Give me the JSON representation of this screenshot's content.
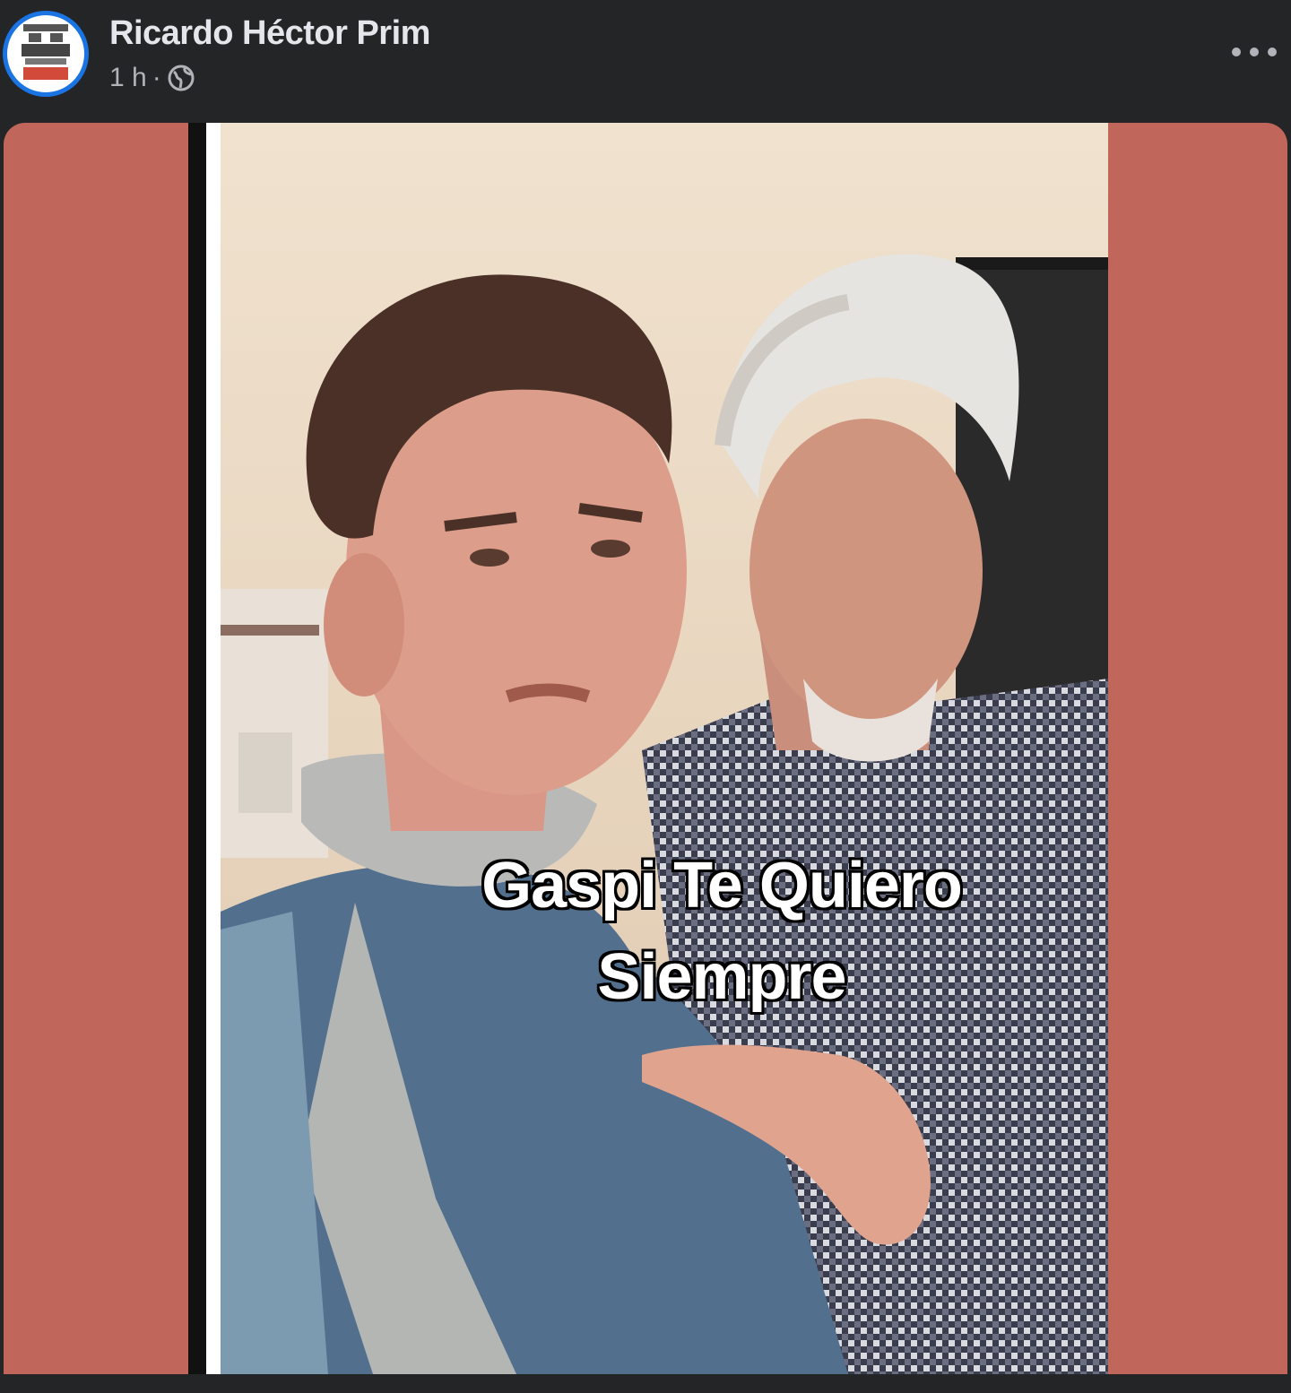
{
  "post": {
    "author": "Ricardo Héctor Prim",
    "time": "1 h",
    "separator": "·",
    "privacy_icon": "globe-icon",
    "more_icon": "more-options-icon"
  },
  "image": {
    "caption_line1": "Gaspi Te Quiero",
    "caption_line2": "Siempre",
    "background_color": "#c0665a"
  }
}
